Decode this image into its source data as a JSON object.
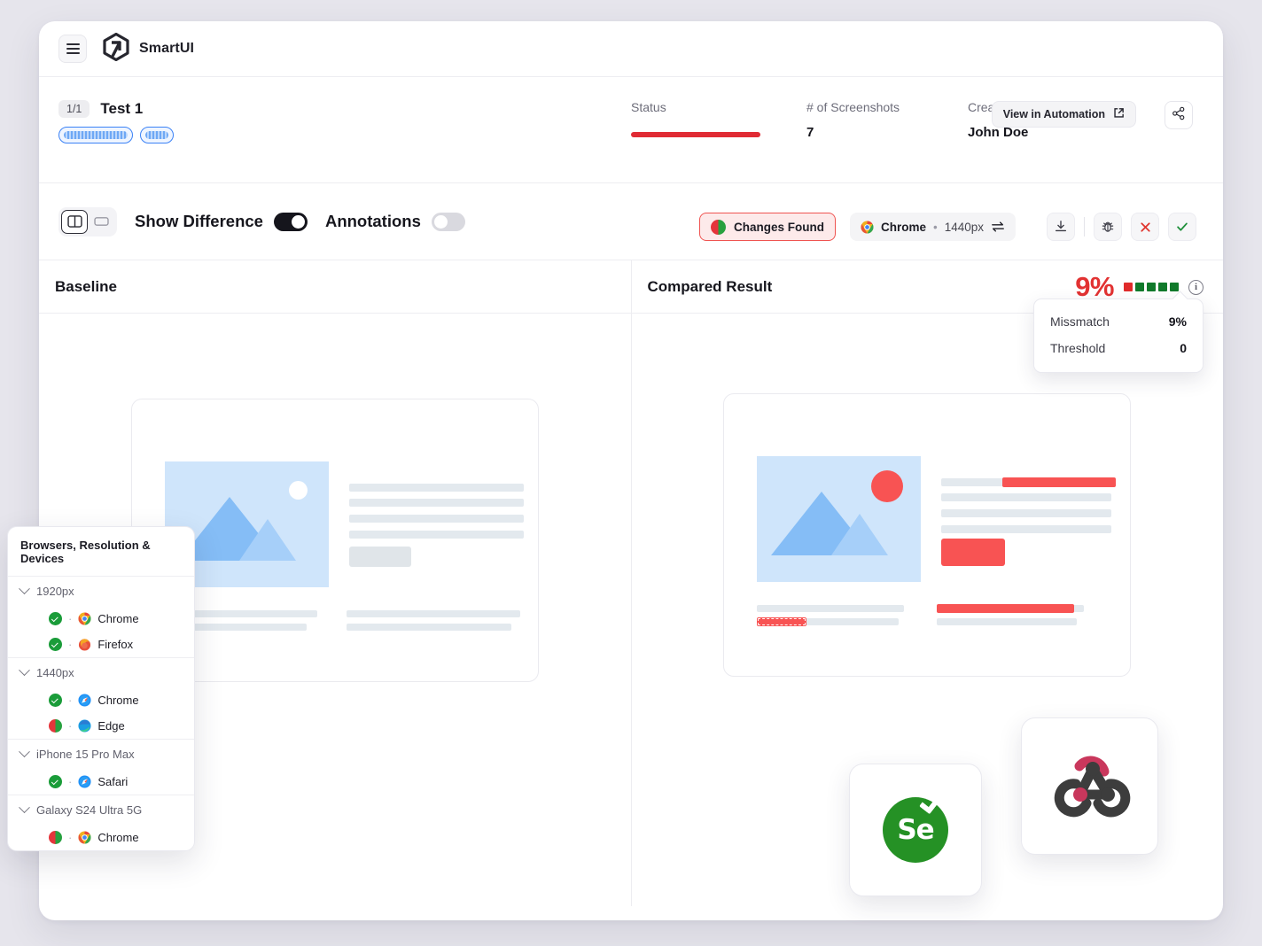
{
  "app": {
    "brand_name": "SmartUI",
    "menu_icon": "hamburger-icon",
    "logo_icon": "smartui-logo-icon"
  },
  "meta": {
    "test_counter": "1/1",
    "test_title": "Test 1",
    "status_label": "Status",
    "status_color": "#e02b34",
    "screenshots_label": "# of Screenshots",
    "screenshots_count": "7",
    "created_by_label": "Created by",
    "created_by_value": "John Doe",
    "automation_button": "View in Automation",
    "automation_icon": "external-link-icon",
    "share_icon": "share-icon"
  },
  "toolbar": {
    "split_view_icon": "split-view-icon",
    "single_view_icon": "single-view-icon",
    "show_difference_label": "Show Difference",
    "show_difference_on": true,
    "annotations_label": "Annotations",
    "annotations_on": false,
    "changes_badge": "Changes Found",
    "changes_badge_icon": "diff-split-circle-icon",
    "browser_name": "Chrome",
    "browser_icon": "chrome-icon",
    "separator_dot": "•",
    "resolution": "1440px",
    "swap_icon": "swap-arrows-icon",
    "download_icon": "download-icon",
    "bug_icon": "bug-icon",
    "reject_icon": "close-x-icon",
    "approve_icon": "check-icon"
  },
  "compare": {
    "baseline_label": "Baseline",
    "compared_label": "Compared Result",
    "mismatch_percent": "9%",
    "blocks": [
      "#e02b2b",
      "#117a2b",
      "#117a2b",
      "#117a2b",
      "#117a2b"
    ],
    "info_icon": "info-icon",
    "info_glyph": "i",
    "tooltip": {
      "mismatch_key": "Missmatch",
      "mismatch_value": "9%",
      "threshold_key": "Threshold",
      "threshold_value": "0"
    }
  },
  "browsers_panel": {
    "title": "Browsers, Resolution & Devices",
    "groups": [
      {
        "name": "1920px",
        "items": [
          {
            "label": "Chrome",
            "status": "pass",
            "icon": "chrome-icon"
          },
          {
            "label": "Firefox",
            "status": "pass",
            "icon": "firefox-icon"
          }
        ]
      },
      {
        "name": "1440px",
        "items": [
          {
            "label": "Chrome",
            "status": "pass",
            "icon": "safari-icon"
          },
          {
            "label": "Edge",
            "status": "diff",
            "icon": "edge-icon"
          }
        ]
      },
      {
        "name": "iPhone 15 Pro Max",
        "items": [
          {
            "label": "Safari",
            "status": "pass",
            "icon": "safari-icon"
          }
        ]
      },
      {
        "name": "Galaxy S24 Ultra 5G",
        "items": [
          {
            "label": "Chrome",
            "status": "diff",
            "icon": "chrome-icon"
          }
        ]
      }
    ]
  },
  "floating_logos": {
    "selenium_label": "Se",
    "selenium_icon": "selenium-logo-icon",
    "webhook_icon": "webhook-logo-icon"
  }
}
